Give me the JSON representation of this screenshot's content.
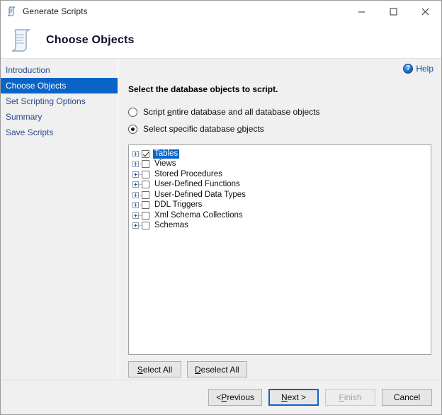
{
  "window": {
    "title": "Generate Scripts",
    "title_icon": "script-scroll-icon",
    "minimize_label": "Minimize",
    "maximize_label": "Maximize",
    "close_label": "Close"
  },
  "header": {
    "title": "Choose Objects",
    "icon": "script-scroll-icon"
  },
  "sidebar": {
    "items": [
      {
        "label": "Introduction",
        "active": false
      },
      {
        "label": "Choose Objects",
        "active": true
      },
      {
        "label": "Set Scripting Options",
        "active": false
      },
      {
        "label": "Summary",
        "active": false
      },
      {
        "label": "Save Scripts",
        "active": false
      }
    ]
  },
  "main": {
    "help_label": "Help",
    "help_icon": "help-circle-icon",
    "instruction": "Select the database objects to script.",
    "radios": [
      {
        "label_before": "Script ",
        "accel": "e",
        "label_after": "ntire database and all database objects",
        "checked": false
      },
      {
        "label_before": "Select specific database ",
        "accel": "o",
        "label_after": "bjects",
        "checked": true
      }
    ],
    "tree": [
      {
        "label": "Tables",
        "checked": true,
        "selected": true
      },
      {
        "label": "Views",
        "checked": false,
        "selected": false
      },
      {
        "label": "Stored Procedures",
        "checked": false,
        "selected": false
      },
      {
        "label": "User-Defined Functions",
        "checked": false,
        "selected": false
      },
      {
        "label": "User-Defined Data Types",
        "checked": false,
        "selected": false
      },
      {
        "label": "DDL Triggers",
        "checked": false,
        "selected": false
      },
      {
        "label": "Xml Schema Collections",
        "checked": false,
        "selected": false
      },
      {
        "label": "Schemas",
        "checked": false,
        "selected": false
      }
    ],
    "select_all": {
      "before": "",
      "accel": "S",
      "after": "elect All"
    },
    "deselect_all": {
      "before": "",
      "accel": "D",
      "after": "eselect All"
    }
  },
  "footer": {
    "previous": {
      "before": "< ",
      "accel": "P",
      "after": "revious",
      "disabled": false,
      "focused": false
    },
    "next": {
      "before": "",
      "accel": "N",
      "after": "ext >",
      "disabled": false,
      "focused": true
    },
    "finish": {
      "before": "",
      "accel": "F",
      "after": "inish",
      "disabled": true,
      "focused": false
    },
    "cancel": {
      "before": "",
      "accel": "",
      "after": "Cancel",
      "disabled": false,
      "focused": false
    }
  },
  "colors": {
    "selection_blue": "#0a64c8",
    "link_blue": "#2b4a8b",
    "window_bg": "#f0f0f0",
    "panel_bg": "#ffffff"
  }
}
